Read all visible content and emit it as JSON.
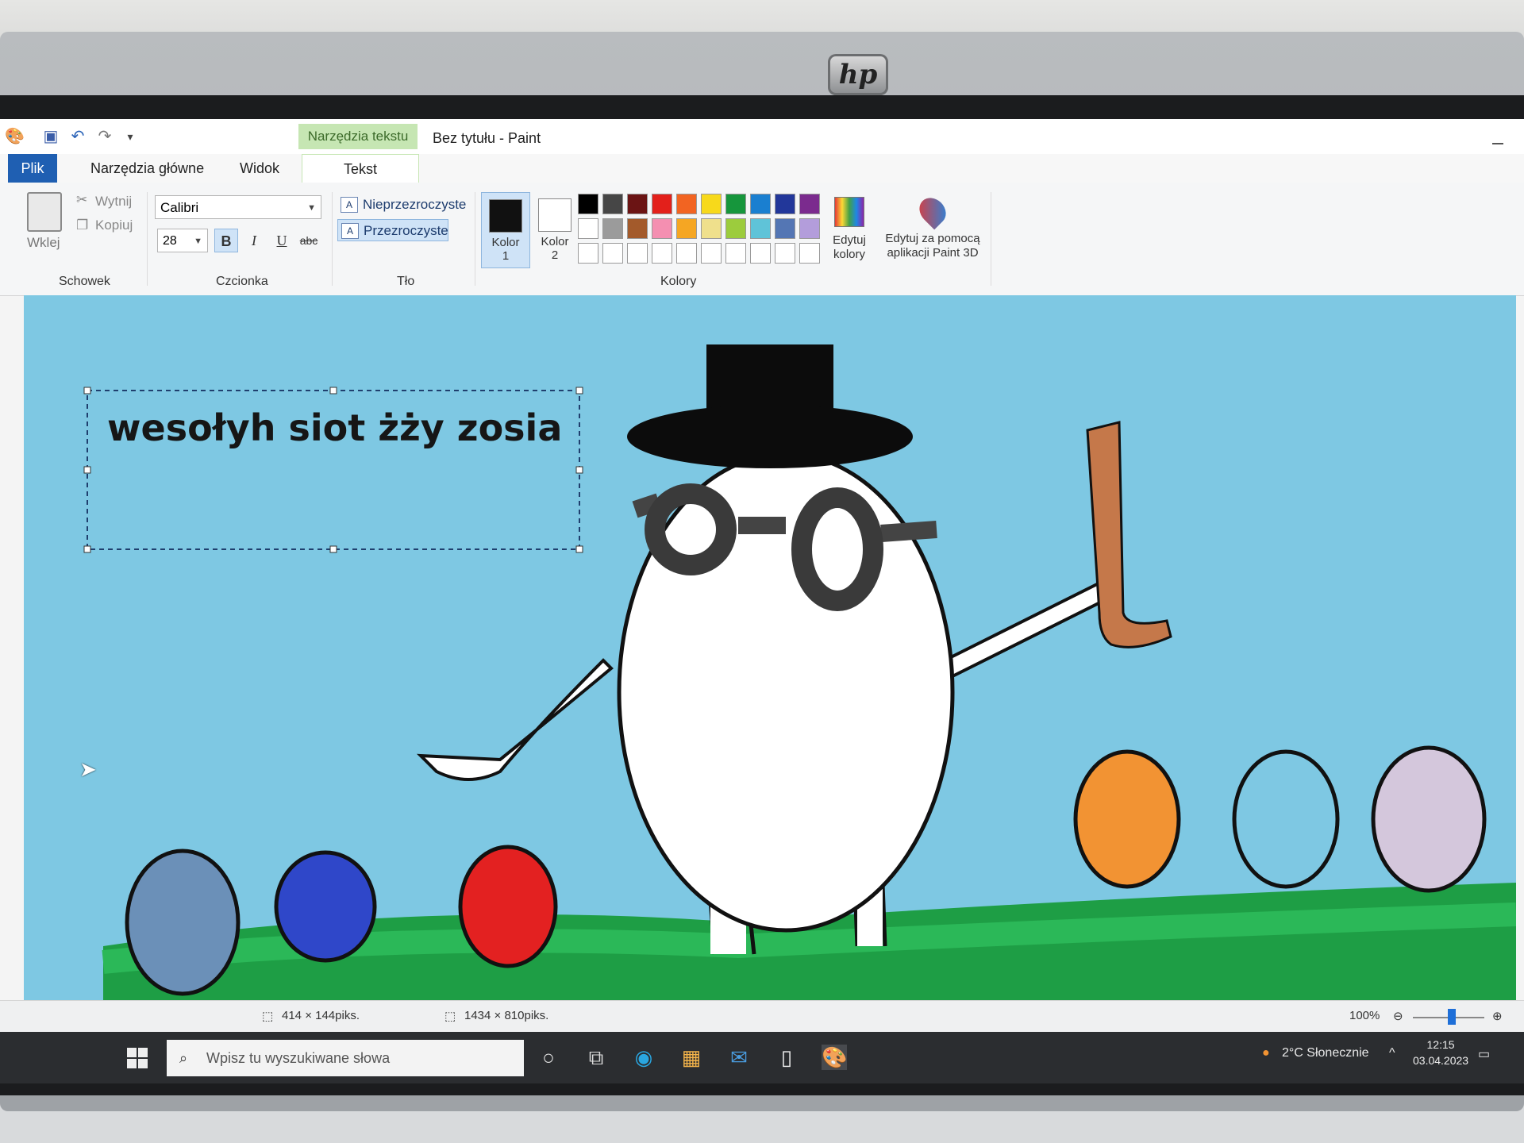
{
  "window": {
    "title": "Bez tytułu - Paint",
    "context_tab": "Narzędzia tekstu"
  },
  "tabs": {
    "file": "Plik",
    "home": "Narzędzia główne",
    "view": "Widok",
    "text": "Tekst"
  },
  "clipboard": {
    "paste": "Wklej",
    "cut": "Wytnij",
    "copy": "Kopiuj",
    "group": "Schowek"
  },
  "font": {
    "family": "Calibri",
    "size": "28",
    "bold": "B",
    "italic": "I",
    "underline": "U",
    "strikethrough": "abc",
    "group": "Czcionka"
  },
  "background": {
    "opaque": "Nieprzezroczyste",
    "transparent": "Przezroczyste",
    "group": "Tło"
  },
  "colors": {
    "color1_label": "Kolor",
    "color1_num": "1",
    "color2_label": "Kolor",
    "color2_num": "2",
    "edit_colors_1": "Edytuj",
    "edit_colors_2": "kolory",
    "paint3d_1": "Edytuj za pomocą",
    "paint3d_2": "aplikacji Paint 3D",
    "group": "Kolory",
    "color1": "#111111",
    "color2": "#ffffff",
    "palette_row1": [
      "#000000",
      "#464646",
      "#6b1414",
      "#e3201b",
      "#f26422",
      "#f7d91b",
      "#16963c",
      "#1a7fd0",
      "#22379a",
      "#7b2b8e"
    ],
    "palette_row2": [
      "#ffffff",
      "#9b9b9b",
      "#a35a2b",
      "#f48fb1",
      "#f5a623",
      "#efe08c",
      "#9ccc3d",
      "#5fc3d8",
      "#5476b4",
      "#b39ddb"
    ]
  },
  "canvas": {
    "text": "wesołyh siot żży zosia",
    "sky": "#7ec8e3",
    "grass": "#1e9e45"
  },
  "status": {
    "selection": "414 × 144piks.",
    "image_size": "1434 × 810piks.",
    "zoom": "100%"
  },
  "taskbar": {
    "search_placeholder": "Wpisz tu wyszukiwane słowa",
    "weather": "2°C  Słonecznie",
    "time": "12:15",
    "date": "03.04.2023"
  }
}
